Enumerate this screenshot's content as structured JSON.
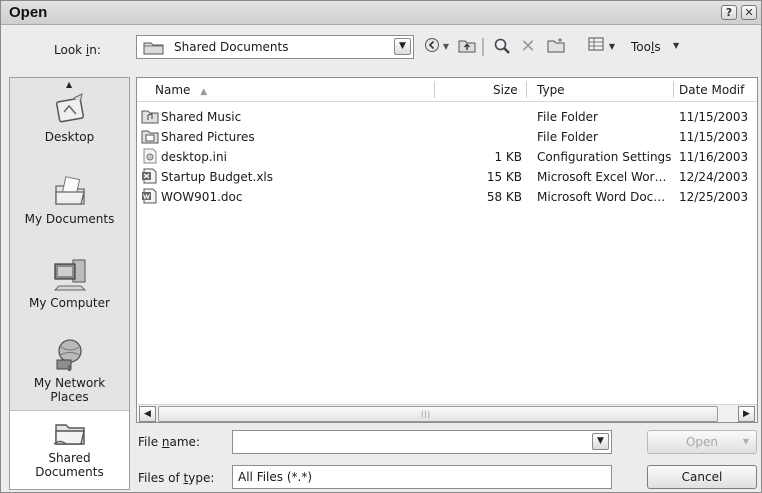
{
  "window": {
    "title": "Open"
  },
  "look_in": {
    "label": "Look in:",
    "value": "Shared Documents"
  },
  "toolbar": {
    "tools_label": "Tools",
    "icons": [
      "back-icon",
      "up-folder-icon",
      "search-web-icon",
      "delete-icon",
      "new-folder-icon",
      "views-icon"
    ]
  },
  "places": [
    {
      "label": "Desktop",
      "icon": "desktop-icon"
    },
    {
      "label": "My Documents",
      "icon": "my-documents-icon"
    },
    {
      "label": "My Computer",
      "icon": "my-computer-icon"
    },
    {
      "label": "My Network Places",
      "icon": "network-places-icon"
    },
    {
      "label": "Shared Documents",
      "icon": "shared-documents-icon",
      "selected": true
    }
  ],
  "file_list": {
    "columns": [
      "Name",
      "Size",
      "Type",
      "Date Modif"
    ],
    "rows": [
      {
        "name": "Shared Music",
        "size": "",
        "type": "File Folder",
        "date": "11/15/2003"
      },
      {
        "name": "Shared Pictures",
        "size": "",
        "type": "File Folder",
        "date": "11/15/2003"
      },
      {
        "name": "desktop.ini",
        "size": "1 KB",
        "type": "Configuration Settings",
        "date": "11/16/2003"
      },
      {
        "name": "Startup Budget.xls",
        "size": "15 KB",
        "type": "Microsoft Excel Wor…",
        "date": "12/24/2003"
      },
      {
        "name": "WOW901.doc",
        "size": "58 KB",
        "type": "Microsoft Word Doc…",
        "date": "12/25/2003"
      }
    ]
  },
  "file_name": {
    "label": "File name:",
    "value": ""
  },
  "files_of_type": {
    "label": "Files of type:",
    "value": "All Files (*.*)"
  },
  "buttons": {
    "open": "Open",
    "cancel": "Cancel"
  }
}
